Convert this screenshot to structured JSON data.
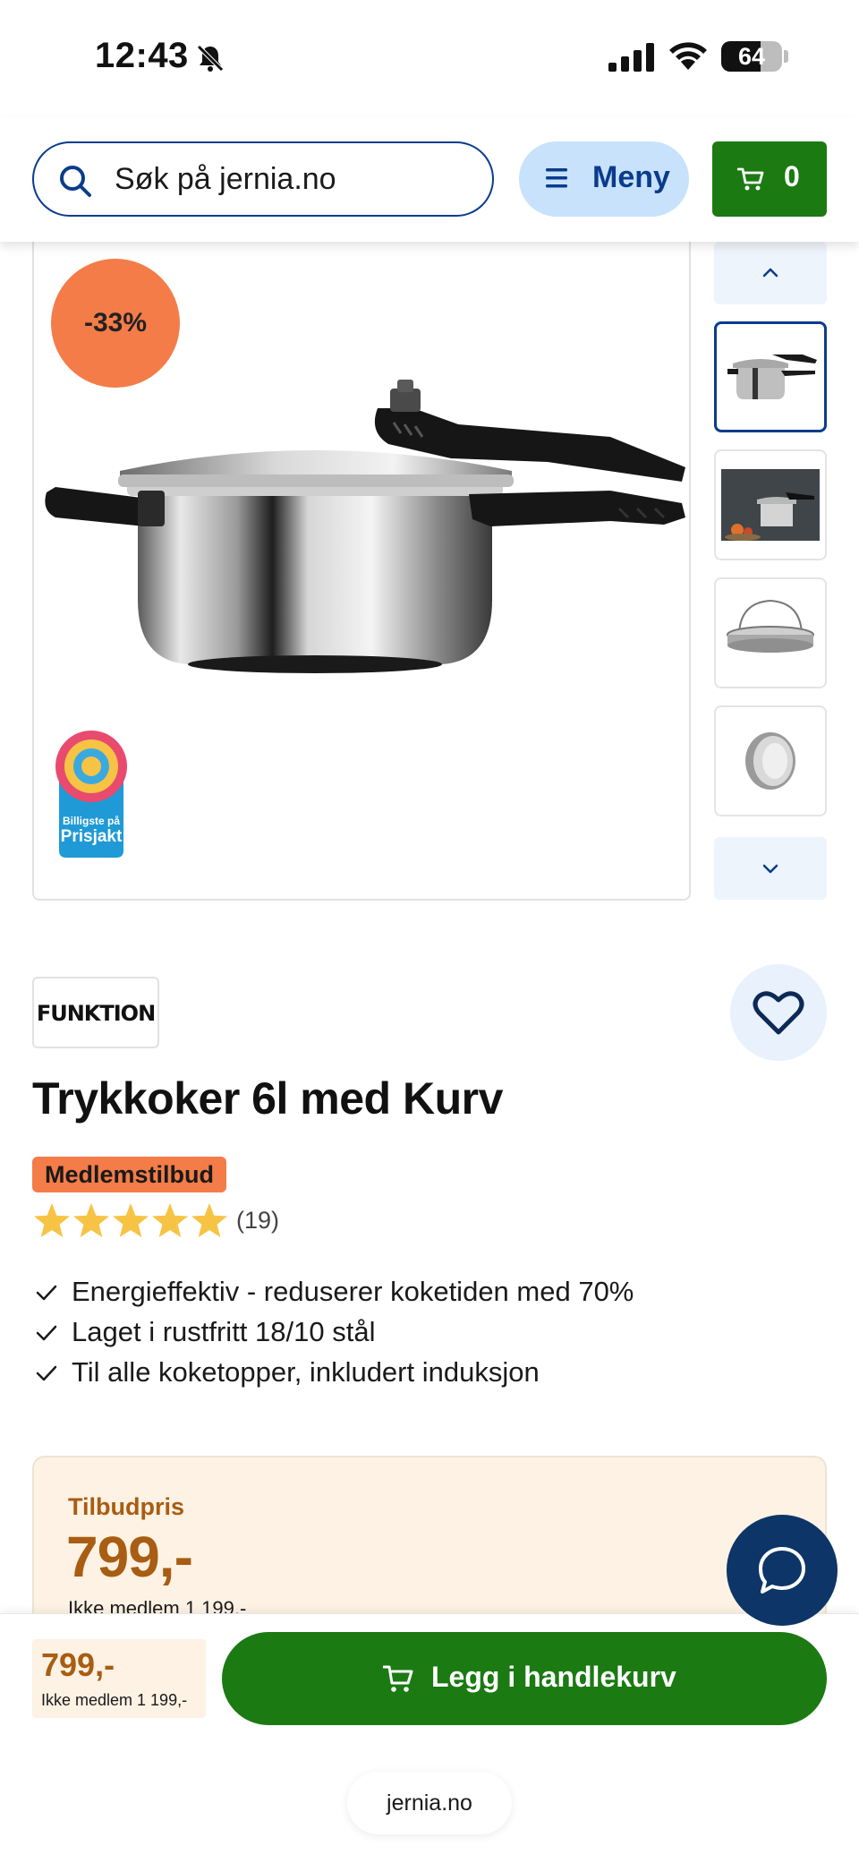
{
  "status_bar": {
    "time": "12:43",
    "battery": "64",
    "battery_level": 0.64
  },
  "header": {
    "search_placeholder": "Søk på jernia.no",
    "menu_label": "Meny",
    "cart_count": "0"
  },
  "gallery": {
    "discount_badge": "-33%",
    "prisjakt_line1": "Billigste på",
    "prisjakt_line2": "Prisjakt",
    "thumbnails": [
      "pressure-cooker",
      "pressure-cooker-kitchen",
      "steamer-basket",
      "valve-part"
    ],
    "selected_thumbnail": 0
  },
  "product": {
    "brand": "FUNKTION",
    "title": "Trykkoker 6l med Kurv",
    "member_badge": "Medlemstilbud",
    "rating": 5,
    "review_count": "(19)",
    "usps": [
      "Energieffektiv - reduserer koketiden med 70%",
      "Laget i rustfritt 18/10 stål",
      "Til alle koketopper, inkludert induksjon"
    ]
  },
  "price": {
    "offer_label": "Tilbudpris",
    "offer_price": "799,-",
    "non_member": "Ikke medlem 1 199,-"
  },
  "bottom_bar": {
    "price": "799,-",
    "non_member": "Ikke medlem 1 199,-",
    "add_to_cart_label": "Legg i handlekurv",
    "url": "jernia.no"
  },
  "colors": {
    "primary_blue": "#0a3c8c",
    "green": "#1b7a12",
    "orange_badge": "#f47c48",
    "price_brown": "#a85d12",
    "price_bg": "#fdf2e4",
    "star": "#f6c344"
  }
}
